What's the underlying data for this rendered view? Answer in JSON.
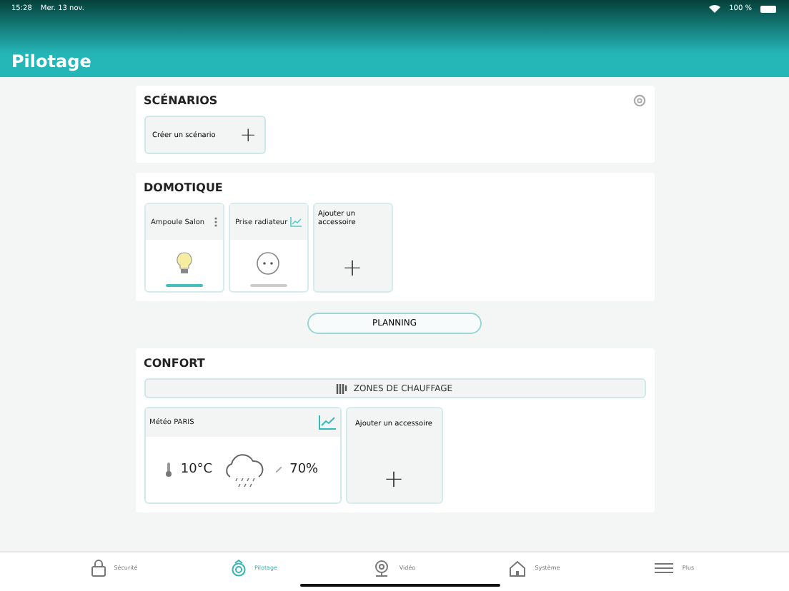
{
  "status_bar": {
    "time": "15:28",
    "date": "Mer. 13 nov.",
    "battery": "100 %"
  },
  "title": "Pilotage",
  "scenarios": {
    "title": "SCÉNARIOS",
    "create_label": "Créer un scénario",
    "create_icon": "+"
  },
  "domotique": {
    "title": "DOMOTIQUE",
    "devices": [
      {
        "name": "Ampoule Salon",
        "kind": "bulb",
        "on": true
      },
      {
        "name": "Prise radiateur",
        "kind": "plug",
        "on": false
      }
    ],
    "add_label": "Ajouter un accessoire",
    "add_icon": "+"
  },
  "planning_button": "PLANNING",
  "confort": {
    "title": "CONFORT",
    "zones_button": "ZONES DE CHAUFFAGE",
    "weather": {
      "title": "Météo PARIS",
      "temperature": "10°C",
      "humidity": "70%"
    },
    "add_label": "Ajouter un accessoire",
    "add_icon": "+"
  },
  "tabs": [
    {
      "label": "Sécurité",
      "kind": "lock",
      "selected": false
    },
    {
      "label": "Pilotage",
      "kind": "pilot",
      "selected": true
    },
    {
      "label": "Vidéo",
      "kind": "camera",
      "selected": false
    },
    {
      "label": "Système",
      "kind": "house",
      "selected": false
    },
    {
      "label": "Plus",
      "kind": "menu",
      "selected": false
    }
  ]
}
